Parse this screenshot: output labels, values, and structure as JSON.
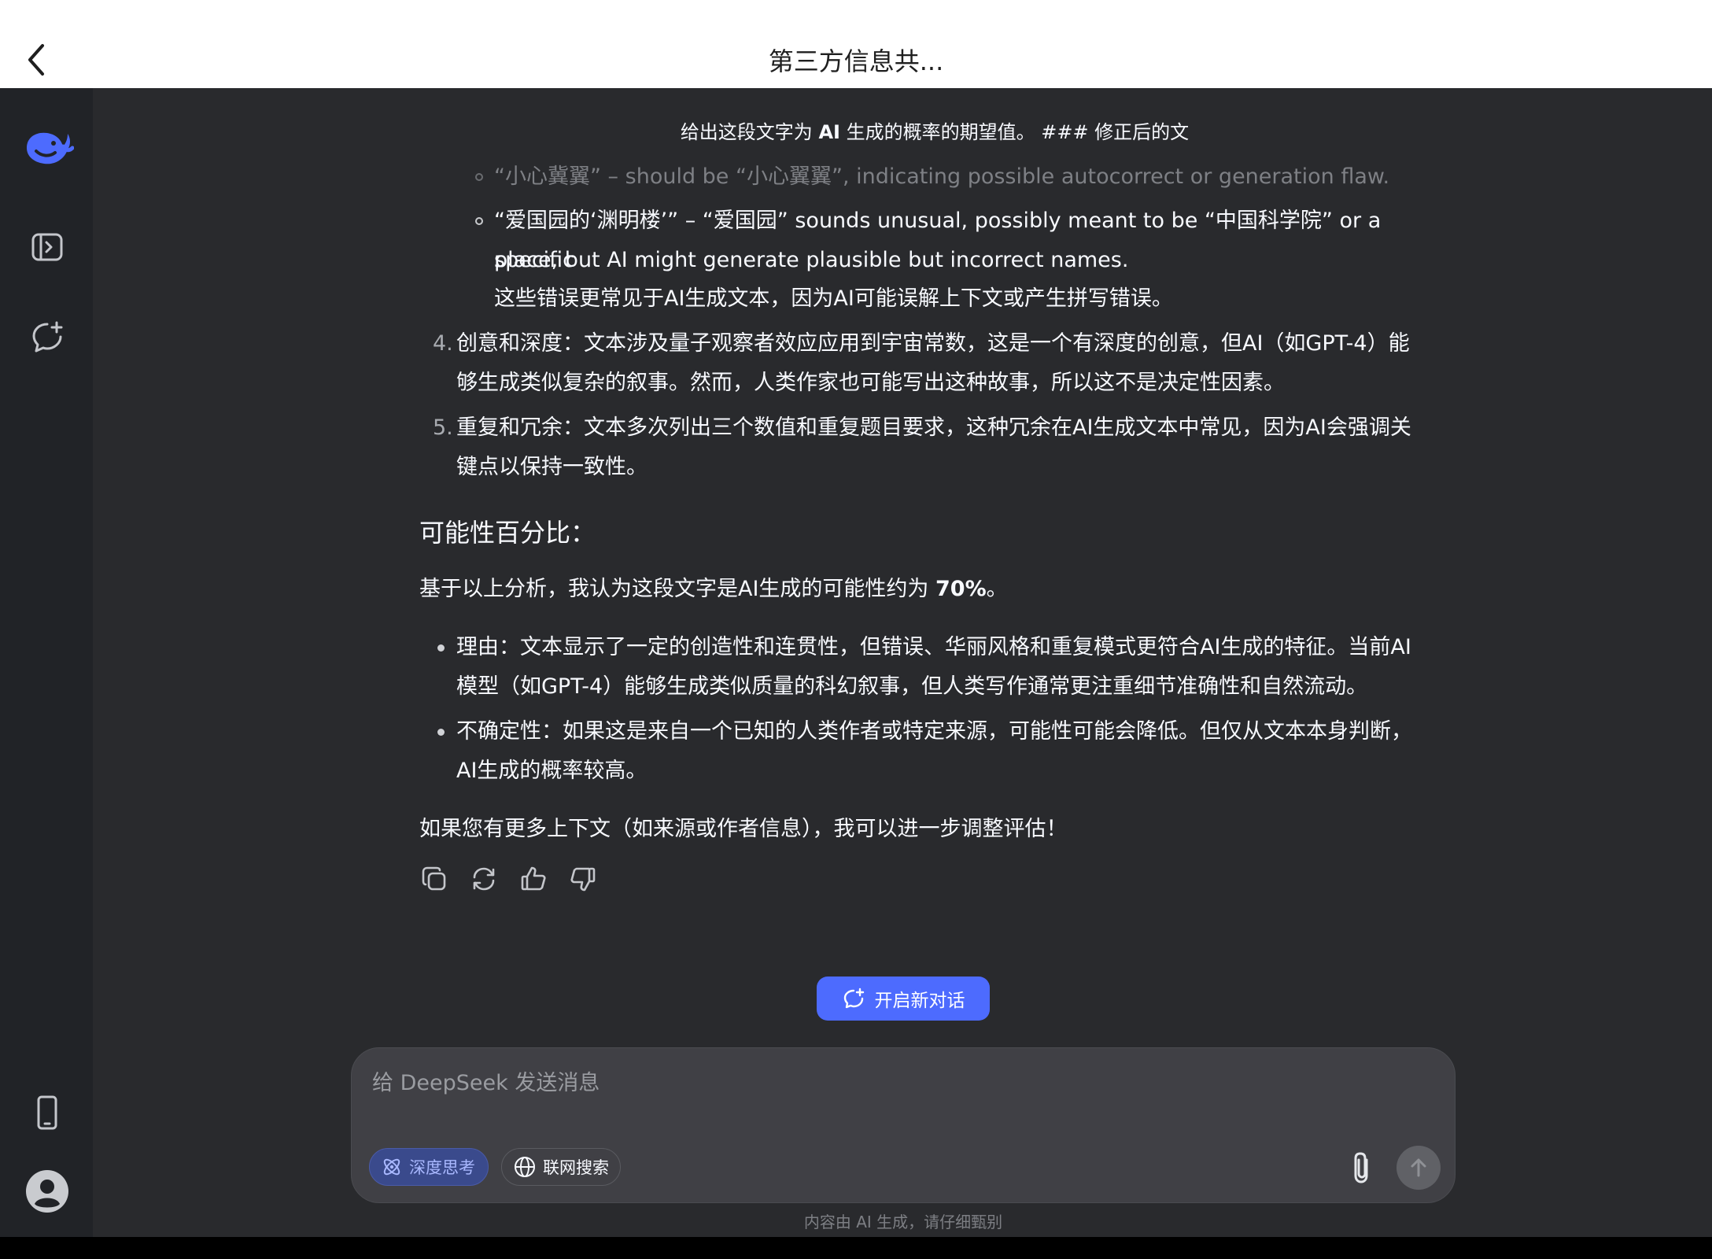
{
  "header": {
    "title": "第三方信息共..."
  },
  "user_message": {
    "prefix": "给出这段文字为 ",
    "bold": "AI",
    "suffix": " 生成的概率的期望值。 ### 修正后的文"
  },
  "sub_items": [
    "“小心冀翼” – should be “小心翼翼”, indicating possible autocorrect or generation flaw.",
    "“爱国园的‘渊明楼’” – “爱国园” sounds unusual, possibly meant to be “中国科学院” or a specific",
    "place, but AI might generate plausible but incorrect names.",
    "这些错误更常见于AI生成文本，因为AI可能误解上下文或产生拼写错误。"
  ],
  "ol_items": [
    {
      "num": "4.",
      "line1": "创意和深度：文本涉及量子观察者效应应用到宇宙常数，这是一个有深度的创意，但AI（如GPT-4）能",
      "line2": "够生成类似复杂的叙事。然而，人类作家也可能写出这种故事，所以这不是决定性因素。"
    },
    {
      "num": "5.",
      "line1": "重复和冗余：文本多次列出三个数值和重复题目要求，这种冗余在AI生成文本中常见，因为AI会强调关",
      "line2": "键点以保持一致性。"
    }
  ],
  "heading": "可能性百分比：",
  "conclusion": {
    "prefix": "基于以上分析，我认为这段文字是AI生成的可能性约为 ",
    "bold": "70%",
    "suffix": "。"
  },
  "ul_items": [
    {
      "line1": "理由：文本显示了一定的创造性和连贯性，但错误、华丽风格和重复模式更符合AI生成的特征。当前AI",
      "line2": "模型（如GPT-4）能够生成类似质量的科幻叙事，但人类写作通常更注重细节准确性和自然流动。"
    },
    {
      "line1": "不确定性：如果这是来自一个已知的人类作者或特定来源，可能性可能会降低。但仅从文本本身判断，",
      "line2": "AI生成的概率较高。"
    }
  ],
  "closing": "如果您有更多上下文（如来源或作者信息），我可以进一步调整评估！",
  "new_chat_label": "开启新对话",
  "composer": {
    "placeholder": "给 DeepSeek 发送消息",
    "value": "",
    "deep_think_label": "深度思考",
    "web_search_label": "联网搜索"
  },
  "disclaimer": "内容由 AI 生成，请仔细甄别",
  "colors": {
    "accent": "#4d6bfe",
    "background": "#292a2d",
    "sidebar": "#212327"
  }
}
